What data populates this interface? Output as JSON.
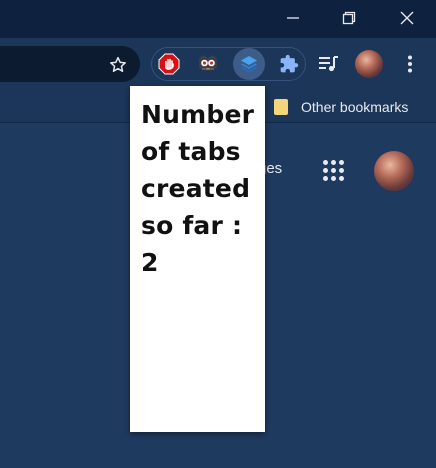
{
  "window_controls": {
    "minimize_icon": "minimize-icon",
    "restore_icon": "restore-icon",
    "close_icon": "close-icon"
  },
  "toolbar": {
    "bookmark_star_icon": "star-outline-icon",
    "extensions": [
      "adblock-hand-icon",
      "owl-extension-icon",
      "tab-counter-layers-icon"
    ],
    "puzzle_icon": "extensions-puzzle-icon",
    "media_icon": "media-control-icon",
    "menu_icon": "three-dot-menu-icon"
  },
  "bookmarks_bar": {
    "other_bookmarks_label": "Other bookmarks"
  },
  "page": {
    "images_link_partial": "ges"
  },
  "popup": {
    "message": "Number of tabs created so far : 2"
  },
  "colors": {
    "titlebar": "#0e2240",
    "toolbar": "#1b3659",
    "content": "#1f3a5f",
    "adblock_red": "#d80f15",
    "tab_counter_blue": "#4aa3f0",
    "puzzle_blue": "#8ab4f8"
  }
}
